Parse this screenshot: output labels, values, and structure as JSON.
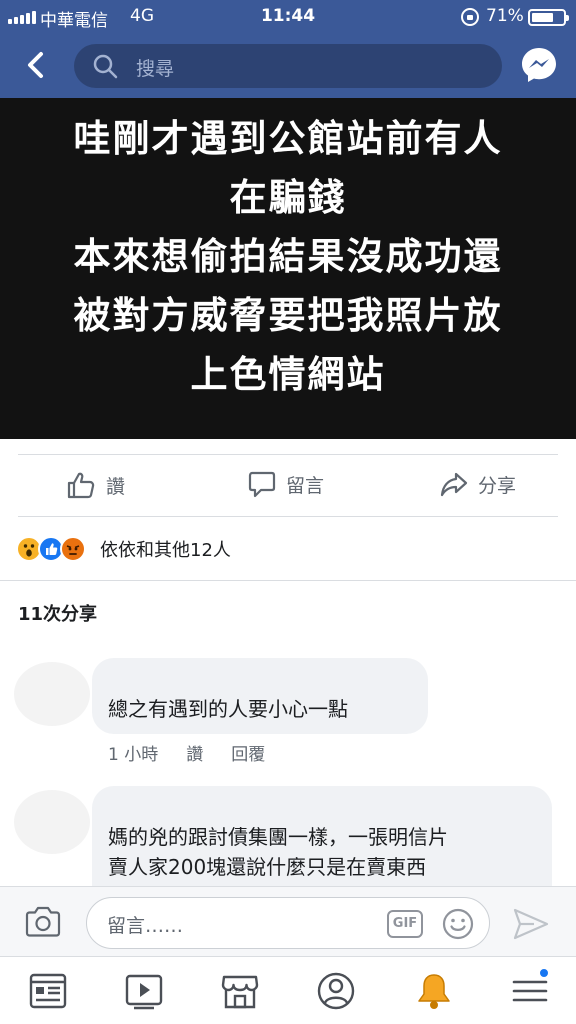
{
  "status_bar": {
    "carrier": "中華電信",
    "network": "4G",
    "time": "11:44",
    "battery_percent": "71%",
    "battery_level": 0.71
  },
  "nav": {
    "search_placeholder": "搜尋",
    "back_icon": "chevron-left-icon",
    "messenger_icon": "messenger-icon"
  },
  "post": {
    "image_text_lines": [
      "哇剛才遇到公館站前有人",
      "在騙錢",
      "本來想偷拍結果沒成功還",
      "被對方威脅要把我照片放",
      "上色情網站"
    ]
  },
  "actions": {
    "like": "讚",
    "comment": "留言",
    "share": "分享"
  },
  "reactions": {
    "label": "依依和其他12人",
    "icons": [
      "wow-icon",
      "like-icon",
      "angry-icon"
    ],
    "colors": {
      "wow": "#f7b125",
      "like": "#1877f2",
      "angry": "#e9710f"
    }
  },
  "shares_count": "11次分享",
  "comments": [
    {
      "text": "總之有遇到的人要小心一點",
      "time": "1 小時",
      "like": "讚",
      "reply": "回覆"
    },
    {
      "text_lines": [
        "媽的兇的跟討債集團一樣，一張明信片",
        "賣人家200塊還說什麼只是在賣東西"
      ]
    }
  ],
  "composer": {
    "placeholder": "留言……",
    "gif_label": "GIF"
  },
  "tabs": [
    "news-feed-icon",
    "watch-icon",
    "marketplace-icon",
    "profile-icon",
    "notifications-icon",
    "menu-icon"
  ],
  "colors": {
    "brand": "#3b5998",
    "notification_bell": "#f5a623"
  }
}
